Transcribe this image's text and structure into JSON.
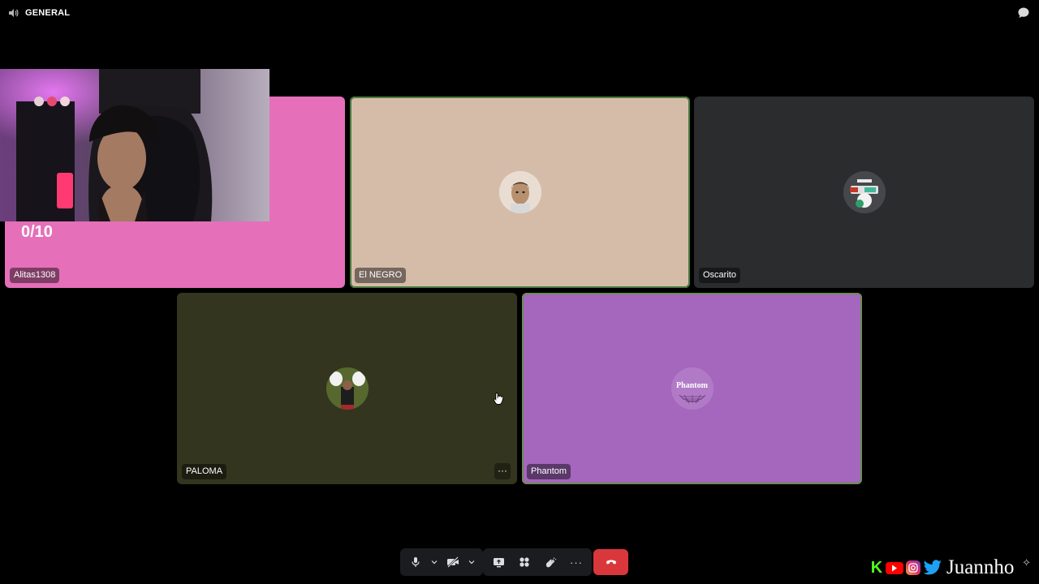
{
  "channel": {
    "name": "GENERAL",
    "speaker_icon": "speaker-icon"
  },
  "header": {
    "chat_icon": "chat-bubble-icon"
  },
  "overlay": {
    "score": "0/10"
  },
  "participants": [
    {
      "name": "Alitas1308",
      "color": "#e56fb9"
    },
    {
      "name": "El NEGRO",
      "color": "#d5bca9"
    },
    {
      "name": "Oscarito",
      "color": "#2b2c2e"
    },
    {
      "name": "PALOMA",
      "color": "#33351e"
    },
    {
      "name": "Phantom",
      "color": "#a566bd",
      "avatar_text": "Phantom"
    }
  ],
  "tile_menu": {
    "label": "···"
  },
  "controls": {
    "mic_icon": "microphone-icon",
    "camera_icon": "camera-off-icon",
    "screenshare_icon": "screen-share-icon",
    "activities_icon": "activities-icon",
    "soundboard_icon": "soundboard-icon",
    "more_icon": "more-icon",
    "disconnect_icon": "phone-hangup-icon",
    "more_label": "···"
  },
  "branding": {
    "handle": "Juannho",
    "kick_label": "K"
  },
  "colors": {
    "hangup": "#da373c",
    "speaking_border": "#4a7a3d"
  }
}
